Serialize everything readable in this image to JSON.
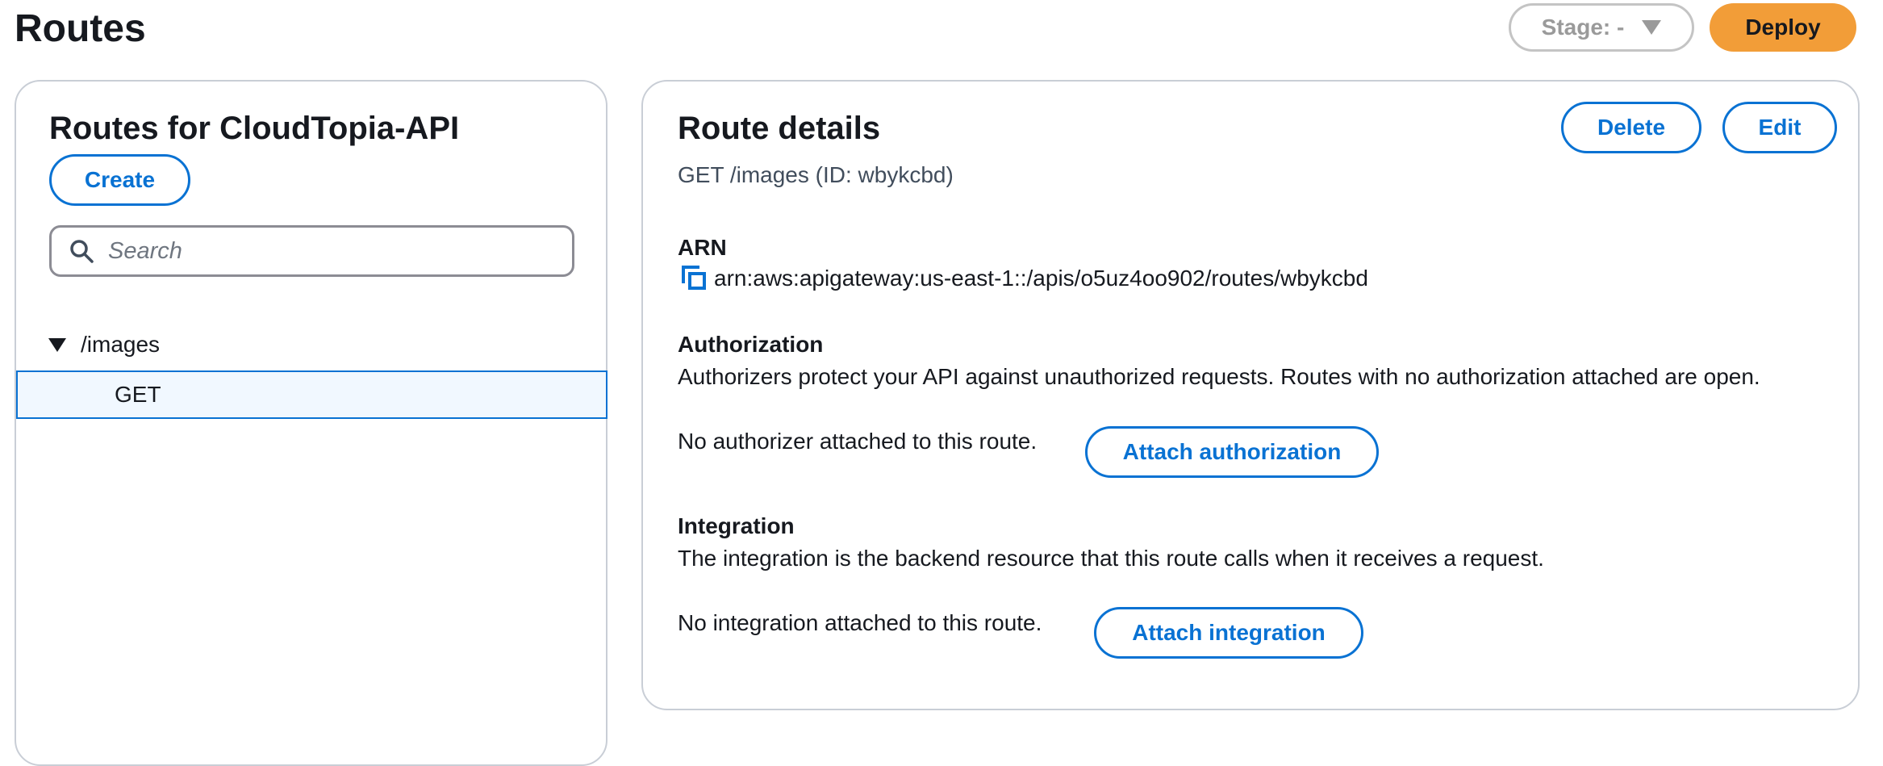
{
  "page": {
    "title": "Routes"
  },
  "toolbar": {
    "stage_label": "Stage: -",
    "deploy_label": "Deploy"
  },
  "routes_panel": {
    "title": "Routes for CloudTopia-API",
    "create_label": "Create",
    "search_placeholder": "Search",
    "tree": {
      "group_label": "/images",
      "items": [
        {
          "label": "GET",
          "selected": true
        }
      ]
    }
  },
  "details": {
    "title": "Route details",
    "subtitle": "GET /images (ID: wbykcbd)",
    "delete_label": "Delete",
    "edit_label": "Edit",
    "arn": {
      "label": "ARN",
      "value": "arn:aws:apigateway:us-east-1::/apis/o5uz4oo902/routes/wbykcbd"
    },
    "authorization": {
      "label": "Authorization",
      "description": "Authorizers protect your API against unauthorized requests. Routes with no authorization attached are open.",
      "status": "No authorizer attached to this route.",
      "button_label": "Attach authorization"
    },
    "integration": {
      "label": "Integration",
      "description": "The integration is the backend resource that this route calls when it receives a request.",
      "status": "No integration attached to this route.",
      "button_label": "Attach integration"
    }
  },
  "colors": {
    "accent": "#0972d3",
    "deploy": "#f29d38",
    "border": "#c9ced6"
  }
}
